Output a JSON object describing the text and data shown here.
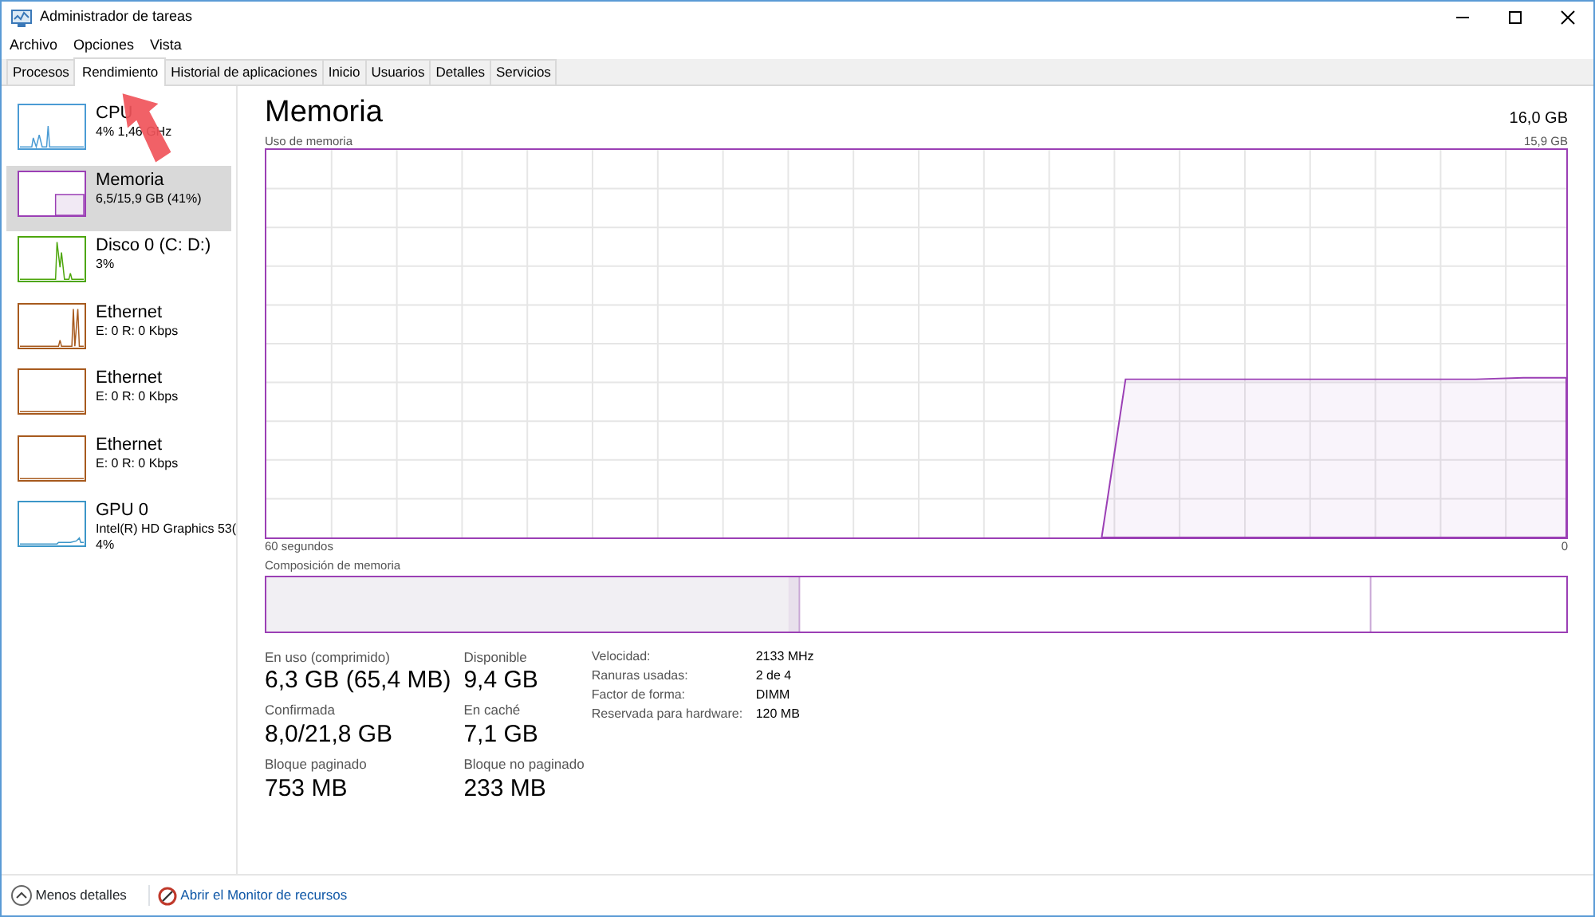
{
  "window": {
    "title": "Administrador de tareas"
  },
  "menu": [
    "Archivo",
    "Opciones",
    "Vista"
  ],
  "tabs": [
    {
      "label": "Procesos",
      "selected": false
    },
    {
      "label": "Rendimiento",
      "selected": true
    },
    {
      "label": "Historial de aplicaciones",
      "selected": false
    },
    {
      "label": "Inicio",
      "selected": false
    },
    {
      "label": "Usuarios",
      "selected": false
    },
    {
      "label": "Detalles",
      "selected": false
    },
    {
      "label": "Servicios",
      "selected": false
    }
  ],
  "sidebar": {
    "items": [
      {
        "kind": "cpu",
        "title": "CPU",
        "lines": [
          "4% 1,46 GHz"
        ],
        "color": "#4a9bd4",
        "selected": false
      },
      {
        "kind": "memory",
        "title": "Memoria",
        "lines": [
          "6,5/15,9 GB (41%)"
        ],
        "color": "#9b3fb5",
        "selected": true
      },
      {
        "kind": "disk",
        "title": "Disco 0 (C: D:)",
        "lines": [
          "3%"
        ],
        "color": "#4da60c",
        "selected": false
      },
      {
        "kind": "network",
        "title": "Ethernet",
        "lines": [
          "E: 0 R: 0 Kbps"
        ],
        "color": "#a75a1e",
        "selected": false
      },
      {
        "kind": "idle",
        "title": "Ethernet",
        "lines": [
          "E: 0 R: 0 Kbps"
        ],
        "color": "#a75a1e",
        "selected": false
      },
      {
        "kind": "idle",
        "title": "Ethernet",
        "lines": [
          "E: 0 R: 0 Kbps"
        ],
        "color": "#a75a1e",
        "selected": false
      },
      {
        "kind": "gpu",
        "title": "GPU 0",
        "lines": [
          "Intel(R) HD Graphics 53(",
          "4%"
        ],
        "color": "#3c96c8",
        "selected": false
      }
    ]
  },
  "main": {
    "title": "Memoria",
    "total": "16,0 GB",
    "graph_label": "Uso de memoria",
    "graph_max": "15,9 GB",
    "x_start": "60 segundos",
    "x_end": "0",
    "composition_label": "Composición de memoria",
    "stats": [
      [
        {
          "label": "En uso (comprimido)",
          "value": "6,3 GB (65,4 MB)"
        },
        {
          "label": "Disponible",
          "value": "9,4 GB"
        }
      ],
      [
        {
          "label": "Confirmada",
          "value": "8,0/21,8 GB"
        },
        {
          "label": "En caché",
          "value": "7,1 GB"
        }
      ],
      [
        {
          "label": "Bloque paginado",
          "value": "753 MB"
        },
        {
          "label": "Bloque no paginado",
          "value": "233 MB"
        }
      ]
    ],
    "details": [
      {
        "label": "Velocidad:",
        "value": "2133 MHz"
      },
      {
        "label": "Ranuras usadas:",
        "value": "2 de 4"
      },
      {
        "label": "Factor de forma:",
        "value": "DIMM"
      },
      {
        "label": "Reservada para hardware:",
        "value": "120 MB"
      }
    ]
  },
  "footer": {
    "less": "Menos detalles",
    "monitor": "Abrir el Monitor de recursos"
  }
}
